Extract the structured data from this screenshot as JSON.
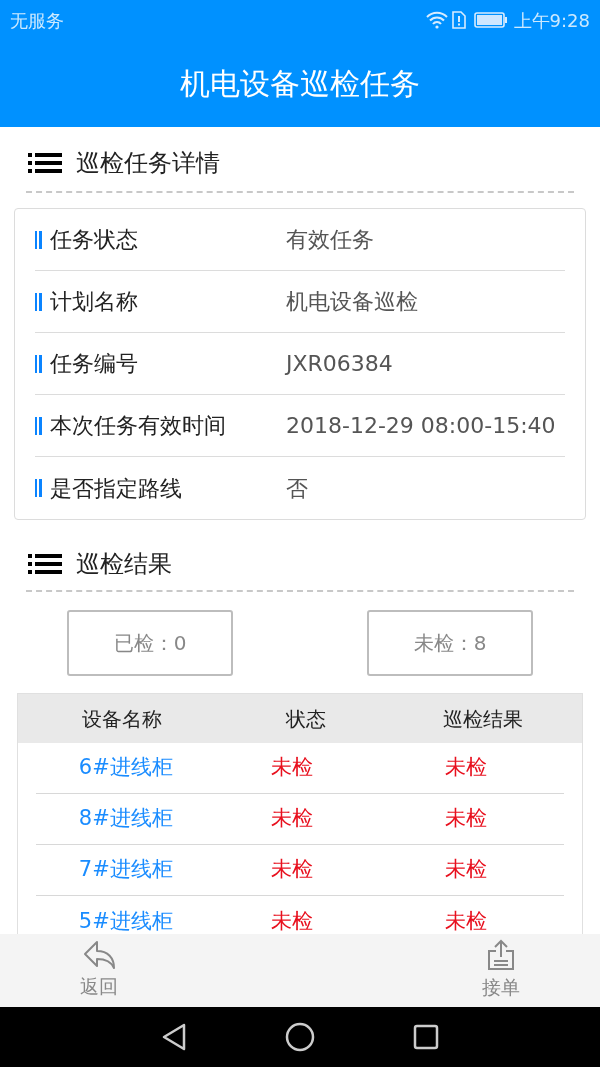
{
  "status_bar": {
    "carrier": "无服务",
    "time": "上午9:28"
  },
  "title": "机电设备巡检任务",
  "details": {
    "heading": "巡检任务详情",
    "fields": [
      {
        "label": "任务状态",
        "value": "有效任务"
      },
      {
        "label": "计划名称",
        "value": "机电设备巡检"
      },
      {
        "label": "任务编号",
        "value": "JXR06384"
      },
      {
        "label": "本次任务有效时间",
        "value": "2018-12-29 08:00-15:40"
      },
      {
        "label": "是否指定路线",
        "value": "否"
      }
    ]
  },
  "results": {
    "heading": "巡检结果",
    "counters": [
      "已检：0",
      "未检：8"
    ],
    "table": {
      "columns": [
        "设备名称",
        "状态",
        "巡检结果"
      ],
      "rows": [
        [
          "6#进线柜",
          "未检",
          "未检"
        ],
        [
          "8#进线柜",
          "未检",
          "未检"
        ],
        [
          "7#进线柜",
          "未检",
          "未检"
        ],
        [
          "5#进线柜",
          "未检",
          "未检"
        ]
      ]
    }
  },
  "bottom_bar": [
    {
      "kind": "back",
      "label": "返回"
    },
    {
      "kind": "accept",
      "label": "接单"
    }
  ]
}
